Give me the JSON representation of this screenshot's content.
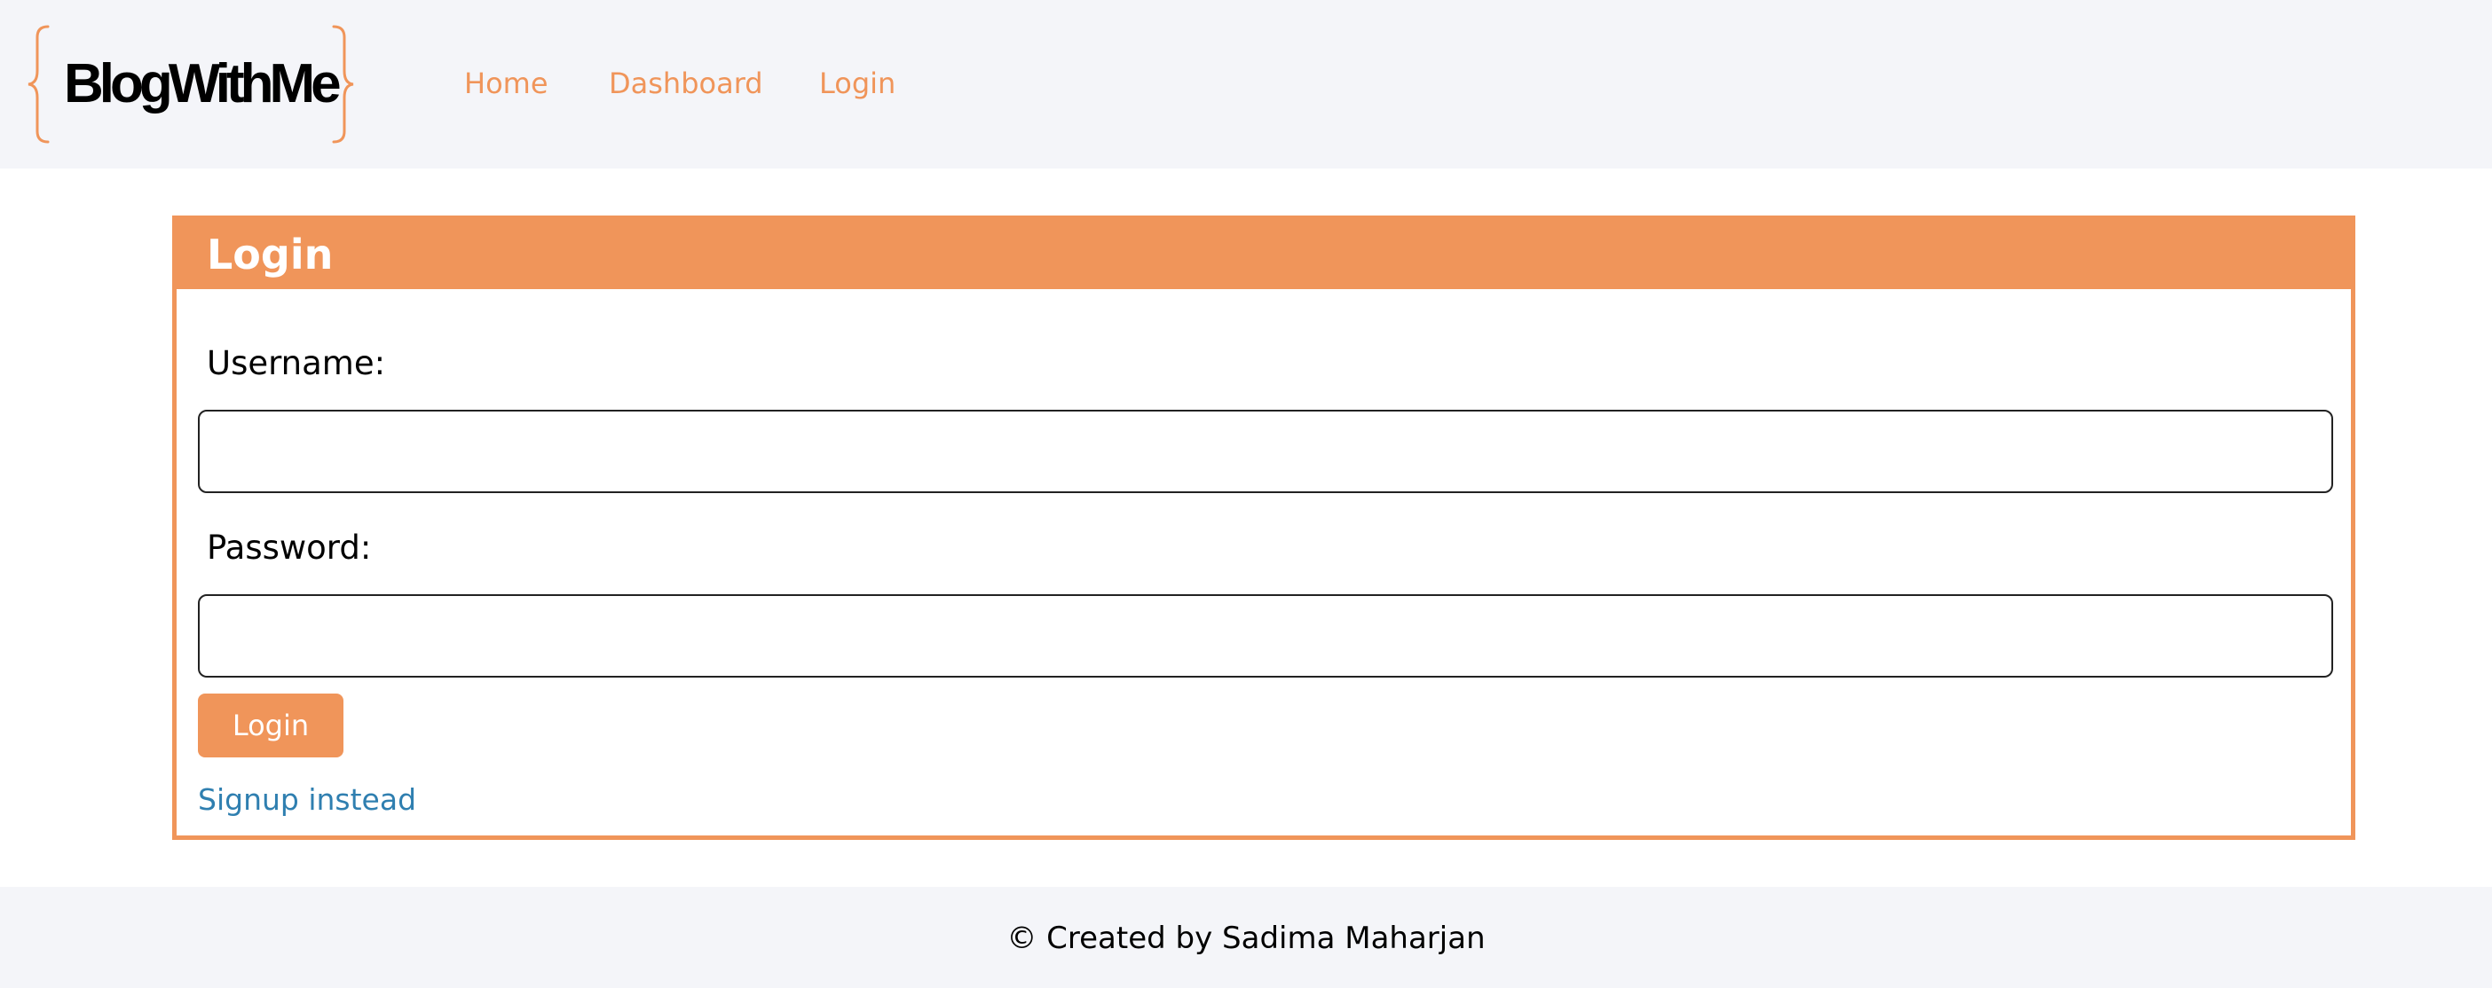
{
  "brand": {
    "name": "BlogWithMe",
    "accent_color": "#f0955a"
  },
  "nav": {
    "links": [
      {
        "label": "Home"
      },
      {
        "label": "Dashboard"
      },
      {
        "label": "Login"
      }
    ]
  },
  "login_card": {
    "title": "Login",
    "username": {
      "label": "Username:",
      "value": "",
      "placeholder": ""
    },
    "password": {
      "label": "Password:",
      "value": "",
      "placeholder": ""
    },
    "submit_label": "Login",
    "signup_link": "Signup instead",
    "link_color": "#2f7fb0"
  },
  "footer": {
    "text": "© Created by Sadima Maharjan"
  }
}
